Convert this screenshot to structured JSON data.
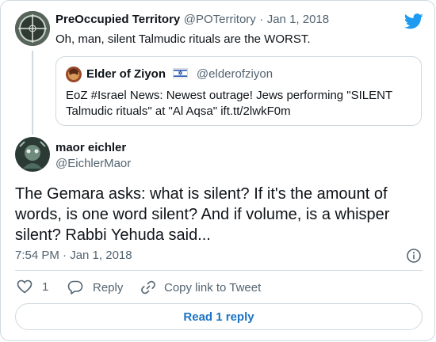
{
  "tweet1": {
    "name": "PreOccupied Territory",
    "handle": "@POTerritory",
    "separator": "·",
    "date": "Jan 1, 2018",
    "text": "Oh, man, silent Talmudic rituals are the WORST."
  },
  "quoted": {
    "name": "Elder of Ziyon",
    "handle": "@elderofziyon",
    "text_line1": "EoZ #Israel News: Newest outrage! Jews performing \"SILENT",
    "text_line2": "Talmudic rituals\" at \"Al Aqsa\" ift.tt/2lwkF0m"
  },
  "tweet2": {
    "name": "maor eichler",
    "handle": "@EichlerMaor",
    "text": "The Gemara asks: what is silent? If it's the amount of words, is one word silent? And if volume, is a whisper silent? Rabbi Yehuda said...",
    "timestamp": "7:54 PM · Jan 1, 2018"
  },
  "actions": {
    "like_count": "1",
    "reply_label": "Reply",
    "copy_label": "Copy link to Tweet"
  },
  "read_reply_label": "Read 1 reply",
  "icons": {
    "brand": "twitter-bird-icon",
    "flag": "israel-flag-icon",
    "info": "info-icon",
    "like": "heart-icon",
    "reply": "reply-bubble-icon",
    "copy": "link-icon"
  },
  "colors": {
    "twitter_blue": "#1d9bf0",
    "link_blue": "#1b74c5",
    "secondary_text": "#536471",
    "border": "#cfd9de"
  }
}
